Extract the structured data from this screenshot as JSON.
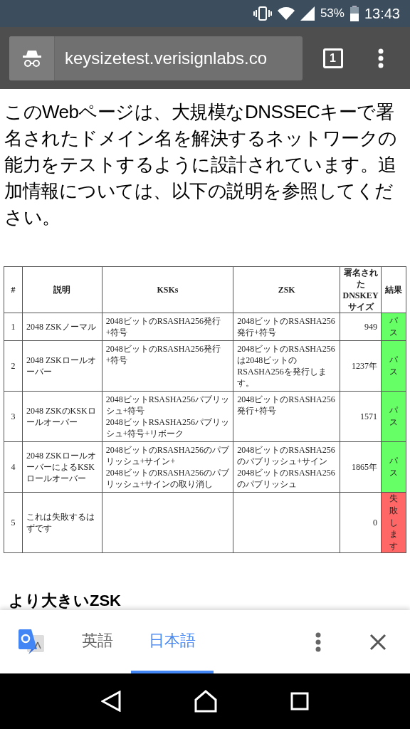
{
  "status_bar": {
    "battery": "53%",
    "time": "13:43"
  },
  "browser": {
    "url": "keysizetest.verisignlabs.co",
    "tab_count": "1"
  },
  "intro": "このWebページは、大規模なDNSSECキーで署名されたドメイン名を解決するネットワークの能力をテストするように設計されています。追加情報については、以下の説明を参照してください。",
  "table": {
    "columns": [
      "#",
      "説明",
      "KSKs",
      "ZSK",
      "署名された DNSKEY サイズ",
      "結果"
    ],
    "rows": [
      {
        "num": "1",
        "description": "2048 ZSKノーマル",
        "ksks": [
          "2048ビットのRSASHA256発行+符号"
        ],
        "zsk": [
          "2048ビットのRSASHA256発行+符号"
        ],
        "size": "949",
        "result": "パス",
        "color": "#66ff66"
      },
      {
        "num": "2",
        "description": "2048 ZSKロールオーバー",
        "ksks": [
          "2048ビットのRSASHA256発行+符号"
        ],
        "zsk": [
          "2048ビットのRSASHA256は2048ビットのRSASHA256を発行します。"
        ],
        "size": "1237年",
        "result": "パス",
        "color": "#66ff66"
      },
      {
        "num": "3",
        "description": "2048 ZSKのKSKロールオーバー",
        "ksks": [
          "2048ビットRSASHA256パブリッシュ+符号",
          "2048ビットRSASHA256パブリッシュ+符号+リボーク"
        ],
        "zsk": [
          "2048ビットのRSASHA256発行+符号"
        ],
        "size": "1571",
        "result": "パス",
        "color": "#66ff66"
      },
      {
        "num": "4",
        "description": "2048 ZSKロールオーバーによるKSKロールオーバー",
        "ksks": [
          "2048ビットのRSASHA256のパブリッシュ+サイン+",
          "2048ビットのRSASHA256のパブリッシュ+サインの取り消し"
        ],
        "zsk": [
          "2048ビットのRSASHA256のパブリッシュ+サイン",
          "2048ビットのRSASHA256のパブリッシュ"
        ],
        "size": "1865年",
        "result": "パス",
        "color": "#66ff66"
      },
      {
        "num": "5",
        "description": "これは失敗するはずです",
        "ksks": [],
        "zsk": [],
        "size": "0",
        "result": "失敗します",
        "color": "#ff6666"
      }
    ]
  },
  "next_heading": "より大きいZSK",
  "translate_bar": {
    "tabs": [
      {
        "label": "英語",
        "selected": false
      },
      {
        "label": "日本語",
        "selected": true
      }
    ]
  }
}
